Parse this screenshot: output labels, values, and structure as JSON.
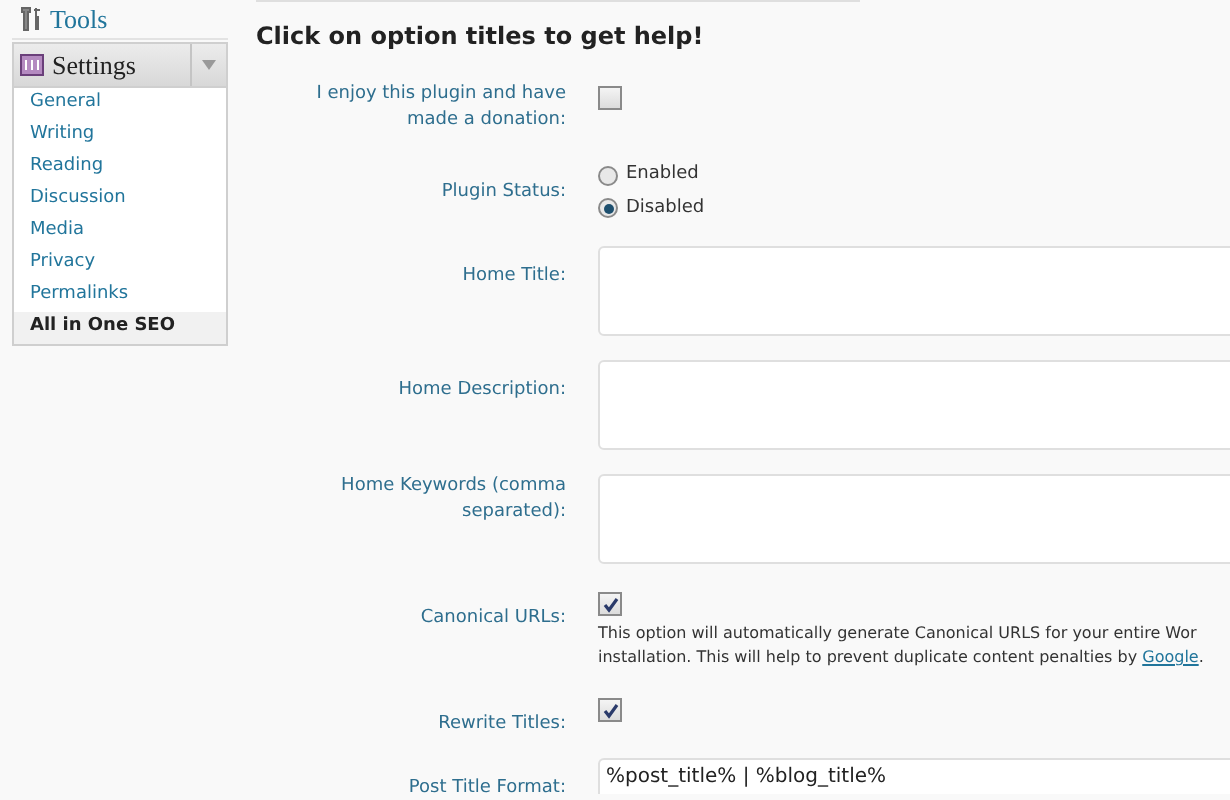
{
  "sidebar": {
    "top_item": {
      "label": "Tools"
    },
    "section": {
      "label": "Settings",
      "expanded": true
    },
    "items": [
      {
        "label": "General",
        "selected": false
      },
      {
        "label": "Writing",
        "selected": false
      },
      {
        "label": "Reading",
        "selected": false
      },
      {
        "label": "Discussion",
        "selected": false
      },
      {
        "label": "Media",
        "selected": false
      },
      {
        "label": "Privacy",
        "selected": false
      },
      {
        "label": "Permalinks",
        "selected": false
      },
      {
        "label": "All in One SEO",
        "selected": true
      }
    ]
  },
  "heading": "Click on option titles to get help!",
  "options": [
    {
      "kind": "checkbox",
      "label": "I enjoy this plugin and have made a donation:",
      "checked": false
    },
    {
      "kind": "radio",
      "label": "Plugin Status:",
      "choices": [
        {
          "label": "Enabled",
          "selected": false
        },
        {
          "label": "Disabled",
          "selected": true
        }
      ]
    },
    {
      "kind": "textarea",
      "label": "Home Title:"
    },
    {
      "kind": "textarea",
      "label": "Home Description:"
    },
    {
      "kind": "textarea",
      "label": "Home Keywords (comma separated):"
    },
    {
      "kind": "checkbox",
      "label": "Canonical URLs:",
      "checked": true,
      "description": [
        "This option will automatically generate Canonical URLS for your entire Wor",
        "installation. This will help to prevent duplicate content penalties by "
      ],
      "link": "Google",
      "description_end": "."
    },
    {
      "kind": "checkbox",
      "label": "Rewrite Titles:",
      "checked": true
    },
    {
      "kind": "text",
      "label": "Post Title Format:",
      "value": "%post_title% | %blog_title%"
    }
  ]
}
